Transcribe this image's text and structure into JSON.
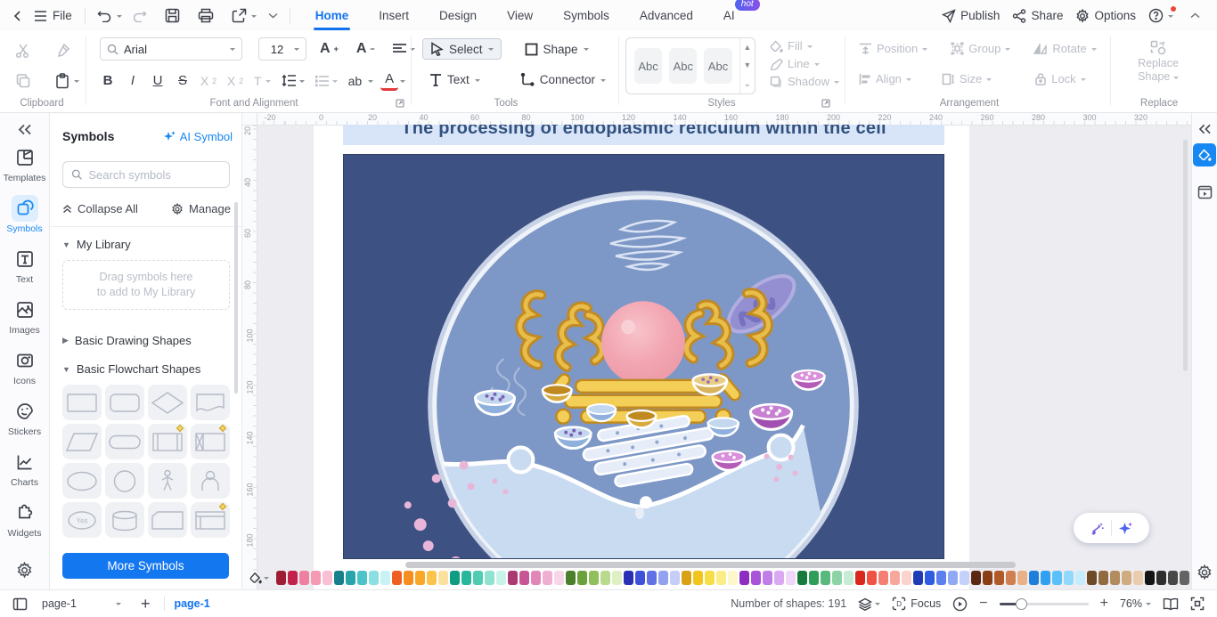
{
  "titlebar": {
    "file_label": "File",
    "tabs": [
      {
        "label": "Home",
        "active": true
      },
      {
        "label": "Insert"
      },
      {
        "label": "Design"
      },
      {
        "label": "View"
      },
      {
        "label": "Symbols"
      },
      {
        "label": "Advanced"
      },
      {
        "label": "AI",
        "badge": "hot"
      }
    ],
    "publish_label": "Publish",
    "share_label": "Share",
    "options_label": "Options"
  },
  "ribbon": {
    "clipboard_caption": "Clipboard",
    "font": {
      "caption": "Font and Alignment",
      "family": "Arial",
      "size": "12",
      "bold": "B",
      "italic": "I",
      "underline": "U",
      "strike": "S",
      "ab": "ab",
      "color_a": "A"
    },
    "tools": {
      "caption": "Tools",
      "select_label": "Select",
      "shape_label": "Shape",
      "text_label": "Text",
      "connector_label": "Connector"
    },
    "styles": {
      "caption": "Styles",
      "tiles": [
        "Abc",
        "Abc",
        "Abc"
      ]
    },
    "effects": {
      "fill_label": "Fill",
      "line_label": "Line",
      "shadow_label": "Shadow"
    },
    "arrangement": {
      "caption": "Arrangement",
      "position_label": "Position",
      "group_label": "Group",
      "rotate_label": "Rotate",
      "align_label": "Align",
      "size_label": "Size",
      "lock_label": "Lock"
    },
    "replace": {
      "caption": "Replace",
      "line1": "Replace",
      "line2": "Shape"
    }
  },
  "left_rail": {
    "items": [
      {
        "label": "Templates",
        "icon": "templates-icon"
      },
      {
        "label": "Symbols",
        "icon": "symbols-icon",
        "active": true
      },
      {
        "label": "Text",
        "icon": "text-icon"
      },
      {
        "label": "Images",
        "icon": "images-icon"
      },
      {
        "label": "Icons",
        "icon": "icons-icon"
      },
      {
        "label": "Stickers",
        "icon": "stickers-icon"
      },
      {
        "label": "Charts",
        "icon": "charts-icon"
      },
      {
        "label": "Widgets",
        "icon": "widgets-icon"
      }
    ]
  },
  "symbols_panel": {
    "title": "Symbols",
    "ai_symbol_label": "AI Symbol",
    "search_placeholder": "Search symbols",
    "collapse_all_label": "Collapse All",
    "manage_label": "Manage",
    "my_library_label": "My Library",
    "dropzone_line1": "Drag symbols here",
    "dropzone_line2": "to add to My Library",
    "basic_drawing_label": "Basic Drawing Shapes",
    "basic_flowchart_label": "Basic Flowchart Shapes",
    "more_button_label": "More Symbols",
    "shapes": [
      {
        "type": "process"
      },
      {
        "type": "rounded-process"
      },
      {
        "type": "decision"
      },
      {
        "type": "document"
      },
      {
        "type": "parallelogram"
      },
      {
        "type": "terminator"
      },
      {
        "type": "predefined-process",
        "badge": true
      },
      {
        "type": "internal-storage",
        "badge": true
      },
      {
        "type": "ellipse"
      },
      {
        "type": "circle"
      },
      {
        "type": "person"
      },
      {
        "type": "user"
      },
      {
        "type": "yes-oval",
        "text": "Yes"
      },
      {
        "type": "cylinder"
      },
      {
        "type": "card"
      },
      {
        "type": "lined-rect",
        "badge": true
      }
    ]
  },
  "canvas": {
    "ruler_h": [
      -20,
      0,
      20,
      40,
      60,
      80,
      100,
      120,
      140,
      160,
      180,
      200,
      220,
      240,
      260,
      280,
      300,
      320
    ],
    "ruler_v": [
      20,
      40,
      60,
      80,
      100,
      120,
      140,
      160,
      180
    ],
    "diagram_title": "The processing of endoplasmic reticulum within the cell"
  },
  "palette": {
    "colors": [
      "#9f1d32",
      "#c2224a",
      "#ef7fa0",
      "#f49ab5",
      "#f8c0d2",
      "#17808c",
      "#27a5ab",
      "#4cc3c9",
      "#8adfe2",
      "#c9f2f4",
      "#ee5f23",
      "#f68d21",
      "#f8a826",
      "#fbc34c",
      "#fce09e",
      "#0f9d82",
      "#27b89c",
      "#4fccb2",
      "#8fe2d0",
      "#c9f3ea",
      "#a93a72",
      "#c85695",
      "#e288b8",
      "#f0aed2",
      "#f8d6e9",
      "#4c7f2b",
      "#6aa33c",
      "#90c05a",
      "#b8da8c",
      "#def0c4",
      "#2a2fb4",
      "#3e51d8",
      "#6272e6",
      "#93a2f0",
      "#c6cef8",
      "#d9a216",
      "#f2c51c",
      "#f7de45",
      "#fbed85",
      "#fdf8c9",
      "#8e2ec0",
      "#a953d8",
      "#c27ee8",
      "#daa9f2",
      "#f0d6fa",
      "#177a3d",
      "#2f9e58",
      "#58b97c",
      "#8cd4a6",
      "#c6ecd6",
      "#d9291d",
      "#ee5344",
      "#f47f72",
      "#f8a79c",
      "#fbd3cd",
      "#1f3cb5",
      "#2f5de2",
      "#5c80ee",
      "#8fa9f5",
      "#c4d2fa",
      "#5c2710",
      "#8a3e14",
      "#b05a28",
      "#d08050",
      "#eab088",
      "#1b7fdb",
      "#2fa0f2",
      "#5cc0f8",
      "#90d9fb",
      "#c6edfd",
      "#6e4a28",
      "#916a40",
      "#b28b5e",
      "#d0ab80",
      "#e9ccab",
      "#141414",
      "#2e2e2e",
      "#484848",
      "#636363",
      "#7d7d7d",
      "#989898",
      "#b3b3b3",
      "#cecece",
      "#e9e9e9"
    ]
  },
  "statusbar": {
    "page_dropdown_value": "page-1",
    "page_tab_label": "page-1",
    "shapes_count": "Number of shapes: 191",
    "focus_label": "Focus",
    "zoom_value": "76%"
  }
}
